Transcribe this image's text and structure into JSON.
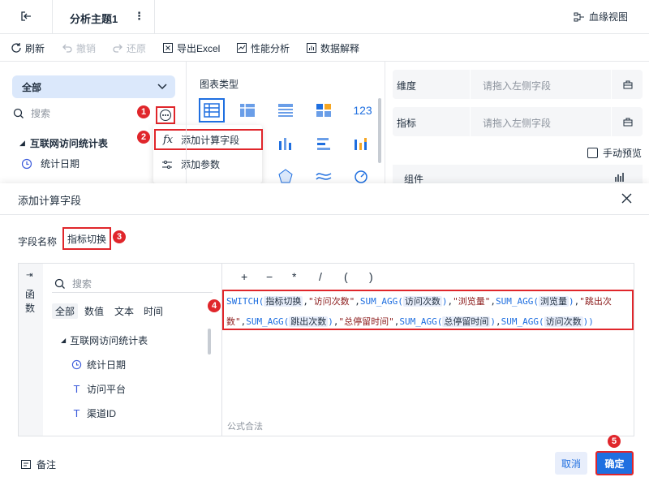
{
  "topbar": {
    "title": "分析主题1",
    "lineage_label": "血缘视图"
  },
  "toolbar": {
    "refresh": "刷新",
    "undo": "撤销",
    "redo": "还原",
    "export": "导出Excel",
    "perf": "性能分析",
    "explain": "数据解释"
  },
  "left": {
    "scope_selected": "全部",
    "search_placeholder": "搜索",
    "table_name": "互联网访问统计表",
    "field_date": "统计日期"
  },
  "more_menu": {
    "add_calc": "添加计算字段",
    "add_param": "添加参数"
  },
  "middle": {
    "chart_type_label": "图表类型",
    "icon_123": "123"
  },
  "right": {
    "dimension_label": "维度",
    "dimension_placeholder": "请拖入左侧字段",
    "metric_label": "指标",
    "metric_placeholder": "请拖入左侧字段",
    "manual_preview": "手动预览",
    "component_label": "组件"
  },
  "dialog": {
    "title": "添加计算字段",
    "field_name_label": "字段名称",
    "field_name_value": "指标切换",
    "side_tab": "函数",
    "search_placeholder": "搜索",
    "tabs": [
      "全部",
      "数值",
      "文本",
      "时间"
    ],
    "table_name": "互联网访问统计表",
    "fields": [
      "统计日期",
      "访问平台",
      "渠道ID"
    ],
    "operators": [
      "+",
      "−",
      "*",
      "/",
      "(",
      ")"
    ],
    "formula": {
      "f1": "SWITCH(",
      "p1": "指标切换",
      "s1": "\"访问次数\"",
      "f2": "SUM_AGG(",
      "p2": "访问次数",
      "s2": "\"浏览量\"",
      "f3": "SUM_AGG(",
      "p3": "浏览量",
      "s3": "\"跳出次数\"",
      "f4": "SUM_AGG(",
      "p4": "跳出次数",
      "s4": "\"总停留时间\"",
      "f5": "SUM_AGG(",
      "p5": "总停留时间",
      "f6": "SUM_AGG(",
      "p6": "访问次数"
    },
    "formula_status": "公式合法",
    "remark": "备注",
    "cancel": "取消",
    "confirm": "确定"
  },
  "badges": [
    "1",
    "2",
    "3",
    "4",
    "5"
  ],
  "colors": {
    "accent": "#1f6fe0",
    "highlight_box": "#e0262b",
    "scope_bg": "#dbe8fb"
  }
}
